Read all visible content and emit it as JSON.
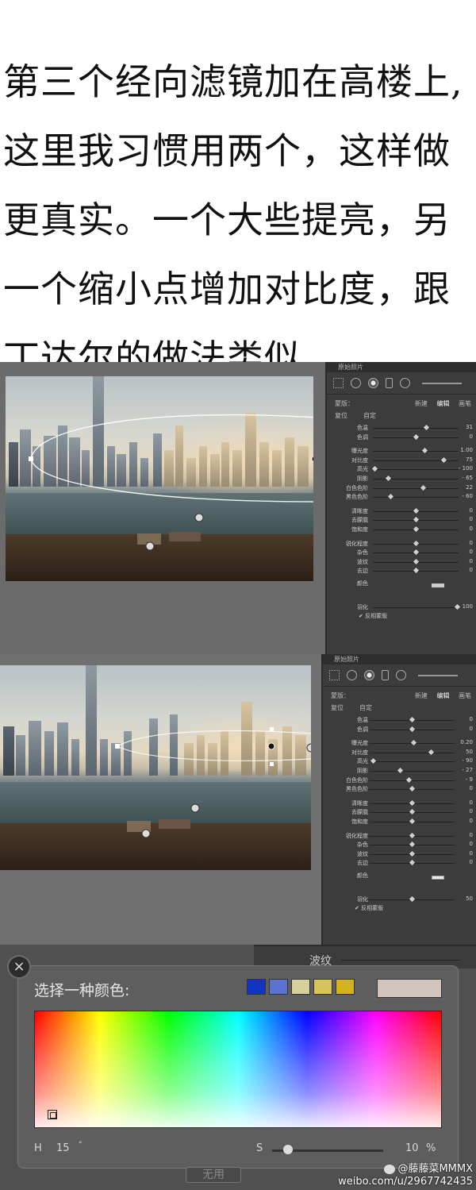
{
  "heading": {
    "lines": [
      "第三个经向滤镜加在高楼上,",
      "这里我习惯用两个，这样做",
      "更真实。一个大些提亮，另",
      "一个缩小点增加对比度，跟",
      "丁达尔的做法类似"
    ]
  },
  "panel1": {
    "title": "原始照片",
    "mask_label": "蒙版：",
    "tabs": [
      "新建",
      "编辑",
      "画笔"
    ],
    "preset_label": "复位",
    "preset_value": "自定",
    "rows": [
      {
        "label": "色温",
        "value": "31",
        "pos": 0.62
      },
      {
        "label": "色调",
        "value": "0",
        "pos": 0.5
      },
      {
        "label": "曝光度",
        "value": "1.00",
        "pos": 0.6
      },
      {
        "label": "对比度",
        "value": "75",
        "pos": 0.82
      },
      {
        "label": "高光",
        "value": "- 100",
        "pos": 0.02
      },
      {
        "label": "阴影",
        "value": "- 65",
        "pos": 0.18
      },
      {
        "label": "白色色阶",
        "value": "22",
        "pos": 0.58
      },
      {
        "label": "黑色色阶",
        "value": "- 60",
        "pos": 0.2
      },
      {
        "label": "清晰度",
        "value": "0",
        "pos": 0.5
      },
      {
        "label": "去朦胧",
        "value": "0",
        "pos": 0.5
      },
      {
        "label": "饱和度",
        "value": "0",
        "pos": 0.5
      },
      {
        "label": "锐化程度",
        "value": "0",
        "pos": 0.5
      },
      {
        "label": "杂色",
        "value": "0",
        "pos": 0.5
      },
      {
        "label": "波纹",
        "value": "0",
        "pos": 0.5
      },
      {
        "label": "去边",
        "value": "0",
        "pos": 0.5
      }
    ],
    "color_label": "颜色",
    "feather_label": "羽化",
    "feather_value": "100",
    "invert_label": "反相蒙版"
  },
  "panel2": {
    "title": "原始照片",
    "mask_label": "蒙版：",
    "tabs": [
      "新建",
      "编辑",
      "画笔"
    ],
    "preset_label": "复位",
    "preset_value": "自定",
    "rows": [
      {
        "label": "色温",
        "value": "0",
        "pos": 0.5
      },
      {
        "label": "色调",
        "value": "0",
        "pos": 0.5
      },
      {
        "label": "曝光度",
        "value": "0.20",
        "pos": 0.52
      },
      {
        "label": "对比度",
        "value": "50",
        "pos": 0.72
      },
      {
        "label": "高光",
        "value": "- 90",
        "pos": 0.05
      },
      {
        "label": "阴影",
        "value": "- 27",
        "pos": 0.36
      },
      {
        "label": "白色色阶",
        "value": "- 9",
        "pos": 0.46
      },
      {
        "label": "黑色色阶",
        "value": "0",
        "pos": 0.5
      },
      {
        "label": "清晰度",
        "value": "0",
        "pos": 0.5
      },
      {
        "label": "去朦胧",
        "value": "0",
        "pos": 0.5
      },
      {
        "label": "饱和度",
        "value": "0",
        "pos": 0.5
      },
      {
        "label": "锐化程度",
        "value": "0",
        "pos": 0.5
      },
      {
        "label": "杂色",
        "value": "0",
        "pos": 0.5
      },
      {
        "label": "波纹",
        "value": "0",
        "pos": 0.5
      },
      {
        "label": "去边",
        "value": "0",
        "pos": 0.5
      }
    ],
    "color_label": "颜色",
    "feather_label": "羽化",
    "feather_value": "50",
    "invert_label": "反相蒙版"
  },
  "behind": {
    "label": "波纹"
  },
  "picker": {
    "title": "选择一种颜色:",
    "close": "×",
    "swatches": [
      "#1233c8",
      "#5c72d0",
      "#d6d09a",
      "#d7c55a",
      "#d2b31a"
    ],
    "current_color": "#d2c3bd",
    "h_label": "H",
    "h_value": "15",
    "h_unit": "°",
    "s_label": "S",
    "s_value": "10",
    "s_unit": "%",
    "s_level": 0.1
  },
  "footer": {
    "button": "无用",
    "watermark_name": "@藤藤菜MMMX",
    "watermark_url": "weibo.com/u/2967742435"
  }
}
